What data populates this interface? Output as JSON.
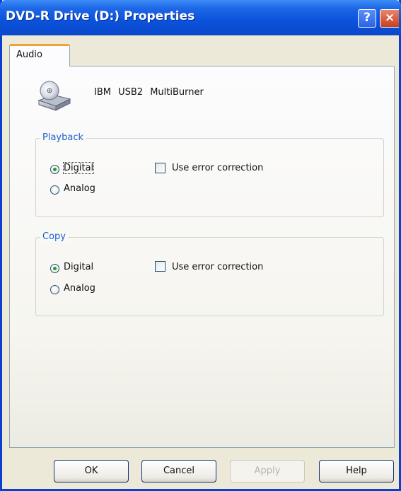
{
  "window": {
    "title": "DVD-R Drive (D:) Properties",
    "help_label": "?",
    "close_label": "×"
  },
  "tabs": [
    {
      "label": "Audio",
      "selected": true
    }
  ],
  "device": {
    "name": "IBM   USB2 MultiBurner",
    "icon": "cd-drive-icon"
  },
  "playback": {
    "legend": "Playback",
    "digital_label": "Digital",
    "analog_label": "Analog",
    "selected": "Digital",
    "error_correction_label": "Use error correction",
    "error_correction_checked": false
  },
  "copy": {
    "legend": "Copy",
    "digital_label": "Digital",
    "analog_label": "Analog",
    "selected": "Digital",
    "error_correction_label": "Use error correction",
    "error_correction_checked": false
  },
  "buttons": {
    "ok": "OK",
    "cancel": "Cancel",
    "apply": "Apply",
    "help": "Help"
  },
  "colors": {
    "titlebar": "#0a48c9",
    "tab_highlight": "#f3a23a",
    "legend_text": "#1f5fd6",
    "radio_dot": "#1fa11f"
  }
}
